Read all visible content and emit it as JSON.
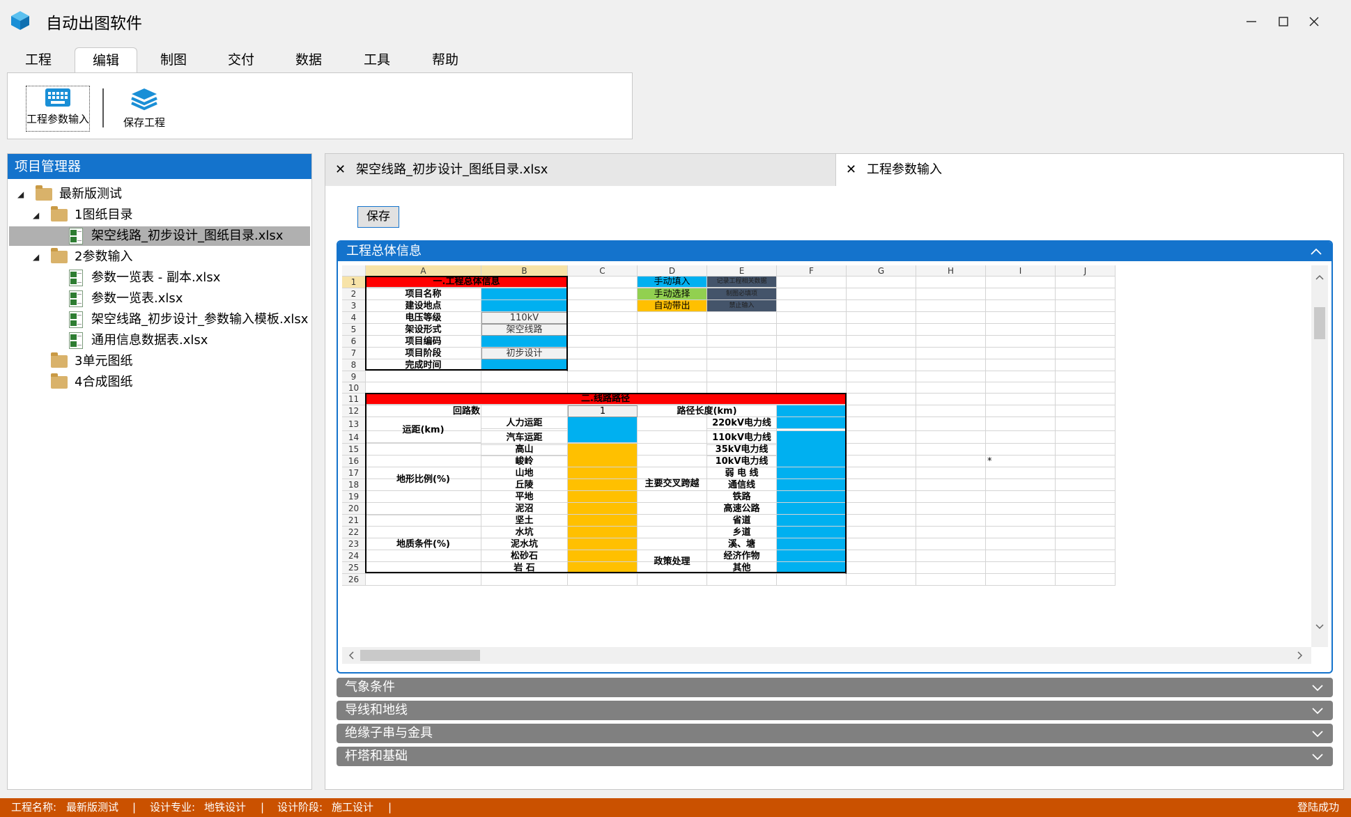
{
  "app": {
    "title": "自动出图软件"
  },
  "menu": {
    "tabs": [
      "工程",
      "编辑",
      "制图",
      "交付",
      "数据",
      "工具",
      "帮助"
    ],
    "active": "编辑"
  },
  "ribbon": {
    "param_input": "工程参数输入",
    "save_project": "保存工程"
  },
  "project_manager": {
    "title": "项目管理器",
    "tree": [
      {
        "label": "最新版测试",
        "type": "folder",
        "level": 0,
        "expanded": true
      },
      {
        "label": "1图纸目录",
        "type": "folder",
        "level": 1,
        "expanded": true
      },
      {
        "label": "架空线路_初步设计_图纸目录.xlsx",
        "type": "xlsx",
        "level": 2,
        "selected": true
      },
      {
        "label": "2参数输入",
        "type": "folder",
        "level": 1,
        "expanded": true
      },
      {
        "label": "参数一览表 - 副本.xlsx",
        "type": "xlsx",
        "level": 2
      },
      {
        "label": "参数一览表.xlsx",
        "type": "xlsx",
        "level": 2
      },
      {
        "label": "架空线路_初步设计_参数输入模板.xlsx",
        "type": "xlsx",
        "level": 2
      },
      {
        "label": "通用信息数据表.xlsx",
        "type": "xlsx",
        "level": 2
      },
      {
        "label": "3单元图纸",
        "type": "folder",
        "level": 1
      },
      {
        "label": "4合成图纸",
        "type": "folder",
        "level": 1
      }
    ]
  },
  "doc_tabs": [
    {
      "label": "架空线路_初步设计_图纸目录.xlsx",
      "active": false
    },
    {
      "label": "工程参数输入",
      "active": true
    }
  ],
  "editor": {
    "save_label": "保存",
    "section_title": "工程总体信息",
    "collapsed_sections": [
      "气象条件",
      "导线和地线",
      "绝缘子串与金具",
      "杆塔和基础"
    ]
  },
  "sheet": {
    "columns": [
      "A",
      "B",
      "C",
      "D",
      "E",
      "F",
      "G",
      "H",
      "I",
      "J"
    ],
    "rows": [
      "1",
      "2",
      "3",
      "4",
      "5",
      "6",
      "7",
      "8",
      "9",
      "10",
      "11",
      "12",
      "13",
      "14",
      "15",
      "16",
      "17",
      "18",
      "19",
      "20",
      "21",
      "22",
      "23",
      "24",
      "25",
      "26"
    ],
    "cells": {
      "title1": "一.工程总体信息",
      "a2": "项目名称",
      "a3": "建设地点",
      "a4": "电压等级",
      "a5": "架设形式",
      "a6": "项目编码",
      "a7": "项目阶段",
      "a8": "完成时间",
      "b4": "110kV",
      "b5": "架空线路",
      "b7": "初步设计",
      "legend1": "手动填入",
      "legend2": "手动选择",
      "legend3": "自动带出",
      "legend1_desc": "记录工程相关数据",
      "legend2_desc": "制图必填项",
      "legend3_desc": "禁止输入",
      "title2": "二.线路路径",
      "a12": "回路数",
      "c12": "1",
      "d12": "路径长度(km)",
      "a13": "运距(km)",
      "b13": "人力运距",
      "b14": "汽车运距",
      "a_terrain": "地形比例(%)",
      "b15": "高山",
      "b16": "峻岭",
      "b17": "山地",
      "b18": "丘陵",
      "b19": "平地",
      "b20": "泥沼",
      "a_geo": "地质条件(%)",
      "b21": "坚土",
      "b22": "水坑",
      "b23": "泥水坑",
      "b24": "松砂石",
      "b25": "岩 石",
      "d_cross": "主要交叉跨越",
      "e13": "220kV电力线",
      "e14": "110kV电力线",
      "e15": "35kV电力线",
      "e16": "10kV电力线",
      "e17": "弱 电 线",
      "e18": "通信线",
      "e19": "铁路",
      "e20": "高速公路",
      "e21": "省道",
      "e22": "乡道",
      "e23": "溪、塘",
      "d_policy": "政策处理",
      "e24": "经济作物",
      "e25": "其他",
      "i16": "*"
    }
  },
  "status": {
    "project_label": "工程名称:",
    "project_value": "最新版测试",
    "major_label": "设计专业:",
    "major_value": "地铁设计",
    "stage_label": "设计阶段:",
    "stage_value": "施工设计",
    "sep": "|",
    "login": "登陆成功"
  },
  "colors": {
    "accent": "#1473cc",
    "status_bar": "#ca5100",
    "manual_input": "#00b0f0",
    "manual_select": "#92d050",
    "auto": "#ffc000",
    "header_red": "#ff0000",
    "legend_dark": "#44546a"
  }
}
